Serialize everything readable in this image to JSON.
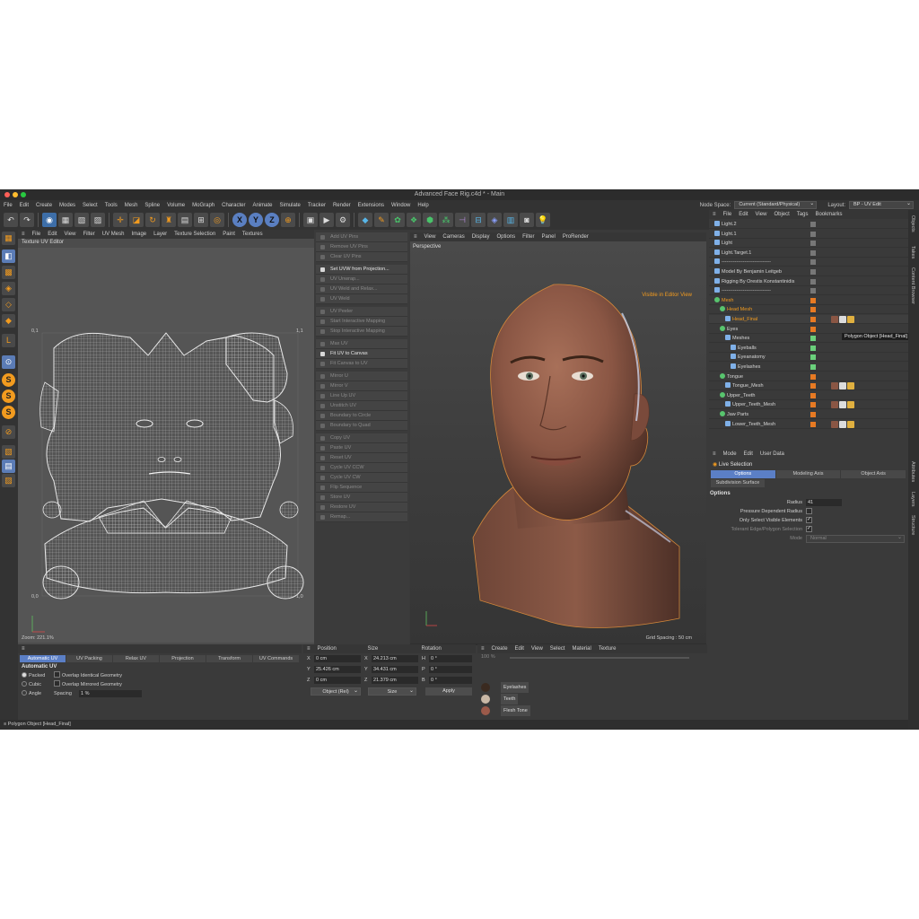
{
  "window": {
    "title": "Advanced Face Rig.c4d * - Main"
  },
  "menu": {
    "items": [
      "File",
      "Edit",
      "Create",
      "Modes",
      "Select",
      "Tools",
      "Mesh",
      "Spline",
      "Volume",
      "MoGraph",
      "Character",
      "Animate",
      "Simulate",
      "Tracker",
      "Render",
      "Extensions",
      "Window",
      "Help"
    ],
    "node_space_label": "Node Space:",
    "node_space_value": "Current (Standard/Physical)",
    "layout_label": "Layout:",
    "layout_value": "BP - UV Edit"
  },
  "uv_editor": {
    "menu": [
      "File",
      "Edit",
      "View",
      "Filter",
      "UV Mesh",
      "Image",
      "Layer",
      "Texture Selection",
      "Paint",
      "Textures"
    ],
    "title": "Texture UV Editor",
    "corner_tl": "0,1",
    "corner_tr": "1,1",
    "corner_bl": "0,0",
    "corner_br": "1,0",
    "zoom": "Zoom: 221.1%"
  },
  "uv_commands": [
    {
      "label": "Add UV Pins",
      "active": false
    },
    {
      "label": "Remove UV Pins",
      "active": false
    },
    {
      "label": "Clear UV Pins",
      "active": false
    },
    {
      "gap": true
    },
    {
      "label": "Set UVW from Projection...",
      "active": true
    },
    {
      "label": "UV Unwrap...",
      "active": false
    },
    {
      "label": "UV Weld and Relax...",
      "active": false
    },
    {
      "label": "UV Weld",
      "active": false
    },
    {
      "gap": true
    },
    {
      "label": "UV Peeler",
      "active": false
    },
    {
      "label": "Start Interactive Mapping",
      "active": false
    },
    {
      "label": "Stop Interactive Mapping",
      "active": false
    },
    {
      "gap": true
    },
    {
      "label": "Max UV",
      "active": false
    },
    {
      "label": "Fit UV to Canvas",
      "active": true
    },
    {
      "label": "Fit Canvas to UV",
      "active": false
    },
    {
      "gap": true
    },
    {
      "label": "Mirror U",
      "active": false
    },
    {
      "label": "Mirror V",
      "active": false
    },
    {
      "label": "Line Up UV",
      "active": false
    },
    {
      "label": "Unstitch UV",
      "active": false
    },
    {
      "label": "Boundary to Circle",
      "active": false
    },
    {
      "label": "Boundary to Quad",
      "active": false
    },
    {
      "gap": true
    },
    {
      "label": "Copy UV",
      "active": false
    },
    {
      "label": "Paste UV",
      "active": false
    },
    {
      "label": "Reset UV",
      "active": false
    },
    {
      "label": "Cycle UV CCW",
      "active": false
    },
    {
      "label": "Cycle UV CW",
      "active": false
    },
    {
      "label": "Flip Sequence",
      "active": false
    },
    {
      "label": "Store UV",
      "active": false
    },
    {
      "label": "Restore UV",
      "active": false
    },
    {
      "label": "Remap...",
      "active": false
    }
  ],
  "viewport": {
    "menu": [
      "View",
      "Cameras",
      "Display",
      "Options",
      "Filter",
      "Panel",
      "ProRender"
    ],
    "camera": "Perspective",
    "visibility_note": "Visible in Editor View",
    "grid_spacing": "Grid Spacing : 50 cm"
  },
  "object_manager": {
    "menu": [
      "File",
      "Edit",
      "View",
      "Object",
      "Tags",
      "Bookmarks"
    ],
    "rows": [
      {
        "name": "Light.2",
        "indent": 0,
        "type": "light",
        "layer": "gray",
        "hl": false
      },
      {
        "name": "Light.1",
        "indent": 0,
        "type": "light",
        "layer": "gray",
        "hl": false
      },
      {
        "name": "Light",
        "indent": 0,
        "type": "light",
        "layer": "gray",
        "hl": false
      },
      {
        "name": "Light.Target.1",
        "indent": 0,
        "type": "light",
        "layer": "gray",
        "hl": false
      },
      {
        "name": "------------------------------",
        "indent": 0,
        "type": "light",
        "layer": "gray",
        "hl": false
      },
      {
        "name": "Model By Benjamin Leitgeb",
        "indent": 0,
        "type": "light",
        "layer": "gray",
        "hl": false
      },
      {
        "name": "Rigging By Orestis Konstantinidis",
        "indent": 0,
        "type": "light",
        "layer": "gray",
        "hl": false
      },
      {
        "name": "------------------------------",
        "indent": 0,
        "type": "light",
        "layer": "gray",
        "hl": false
      },
      {
        "name": "Mesh",
        "indent": 0,
        "type": "null",
        "layer": "orange",
        "hl": false,
        "orange": true
      },
      {
        "name": "Head Mesh",
        "indent": 1,
        "type": "null",
        "layer": "orange",
        "hl": false,
        "orange": true
      },
      {
        "name": "Head_Final",
        "indent": 2,
        "type": "mesh",
        "layer": "orange",
        "hl": true,
        "orange": true
      },
      {
        "name": "Eyes",
        "indent": 1,
        "type": "null",
        "layer": "orange",
        "hl": false
      },
      {
        "name": "Meshes",
        "indent": 2,
        "type": "light",
        "layer": "green",
        "hl": false
      },
      {
        "name": "Eyeballs",
        "indent": 3,
        "type": "light",
        "layer": "green",
        "hl": false
      },
      {
        "name": "Eyeanatomy",
        "indent": 3,
        "type": "light",
        "layer": "green",
        "hl": false
      },
      {
        "name": "Eyelashes",
        "indent": 3,
        "type": "light",
        "layer": "green",
        "hl": false
      },
      {
        "name": "Tongue",
        "indent": 1,
        "type": "null",
        "layer": "orange",
        "hl": false
      },
      {
        "name": "Tongue_Mesh",
        "indent": 2,
        "type": "mesh",
        "layer": "orange",
        "hl": false
      },
      {
        "name": "Upper_Teeth",
        "indent": 1,
        "type": "null",
        "layer": "orange",
        "hl": false
      },
      {
        "name": "Upper_Teeth_Mesh",
        "indent": 2,
        "type": "mesh",
        "layer": "orange",
        "hl": false
      },
      {
        "name": "Jaw Parts",
        "indent": 1,
        "type": "null",
        "layer": "orange",
        "hl": false
      },
      {
        "name": "Lower_Teeth_Mesh",
        "indent": 2,
        "type": "mesh",
        "layer": "orange",
        "hl": false
      }
    ],
    "tooltip": "Polygon Object [Head_Final]"
  },
  "side_tabs": {
    "top": [
      "Objects",
      "Takes",
      "Content Browser"
    ],
    "bottom": [
      "Attributes",
      "Layers",
      "Structure"
    ]
  },
  "attributes": {
    "menu": [
      "Mode",
      "Edit",
      "User Data"
    ],
    "title": "Live Selection",
    "tabs": [
      "Options",
      "Modeling Axis",
      "Object Axis"
    ],
    "subtab": "Subdivision Surface",
    "section": "Options",
    "radius_label": "Radius",
    "radius_value": "41",
    "pressure_label": "Pressure Dependent Radius",
    "only_visible_label": "Only Select Visible Elements",
    "tolerant_label": "Tolerant Edge/Polygon Selection",
    "mode_label": "Mode",
    "mode_value": "Normal"
  },
  "uv_options": {
    "tabs": [
      "Automatic UV",
      "UV Packing",
      "Relax UV",
      "Projection",
      "Transform",
      "UV Commands"
    ],
    "section": "Automatic UV",
    "radio_packed": "Packed",
    "radio_cubic": "Cubic",
    "radio_angle": "Angle",
    "overlap_identical": "Overlap Identical Geometry",
    "overlap_mirrored": "Overlap Mirrored Geometry",
    "spacing_label": "Spacing",
    "spacing_value": "1 %"
  },
  "coordinates": {
    "headers": [
      "Position",
      "Size",
      "Rotation"
    ],
    "rows": [
      {
        "axis": "X",
        "pos": "0 cm",
        "saxis": "X",
        "size": "24.213 cm",
        "raxis": "H",
        "rot": "0 °"
      },
      {
        "axis": "Y",
        "pos": "25.426 cm",
        "saxis": "Y",
        "size": "34.431 cm",
        "raxis": "P",
        "rot": "0 °"
      },
      {
        "axis": "Z",
        "pos": "0 cm",
        "saxis": "Z",
        "size": "21.379 cm",
        "raxis": "B",
        "rot": "0 °"
      }
    ],
    "mode_dropdown": "Object (Rel)",
    "size_dropdown": "Size",
    "apply": "Apply"
  },
  "materials": {
    "menu": [
      "Create",
      "Edit",
      "View",
      "Select",
      "Material",
      "Texture"
    ],
    "zoom": "100 %",
    "items": [
      {
        "name": "Eyelashes",
        "color": "#3a2a20"
      },
      {
        "name": "Teeth",
        "color": "#c9b8a6"
      },
      {
        "name": "Flesh Tone",
        "color": "#9b5a4a"
      }
    ]
  },
  "status": {
    "text": "Polygon Object [Head_Final]"
  }
}
